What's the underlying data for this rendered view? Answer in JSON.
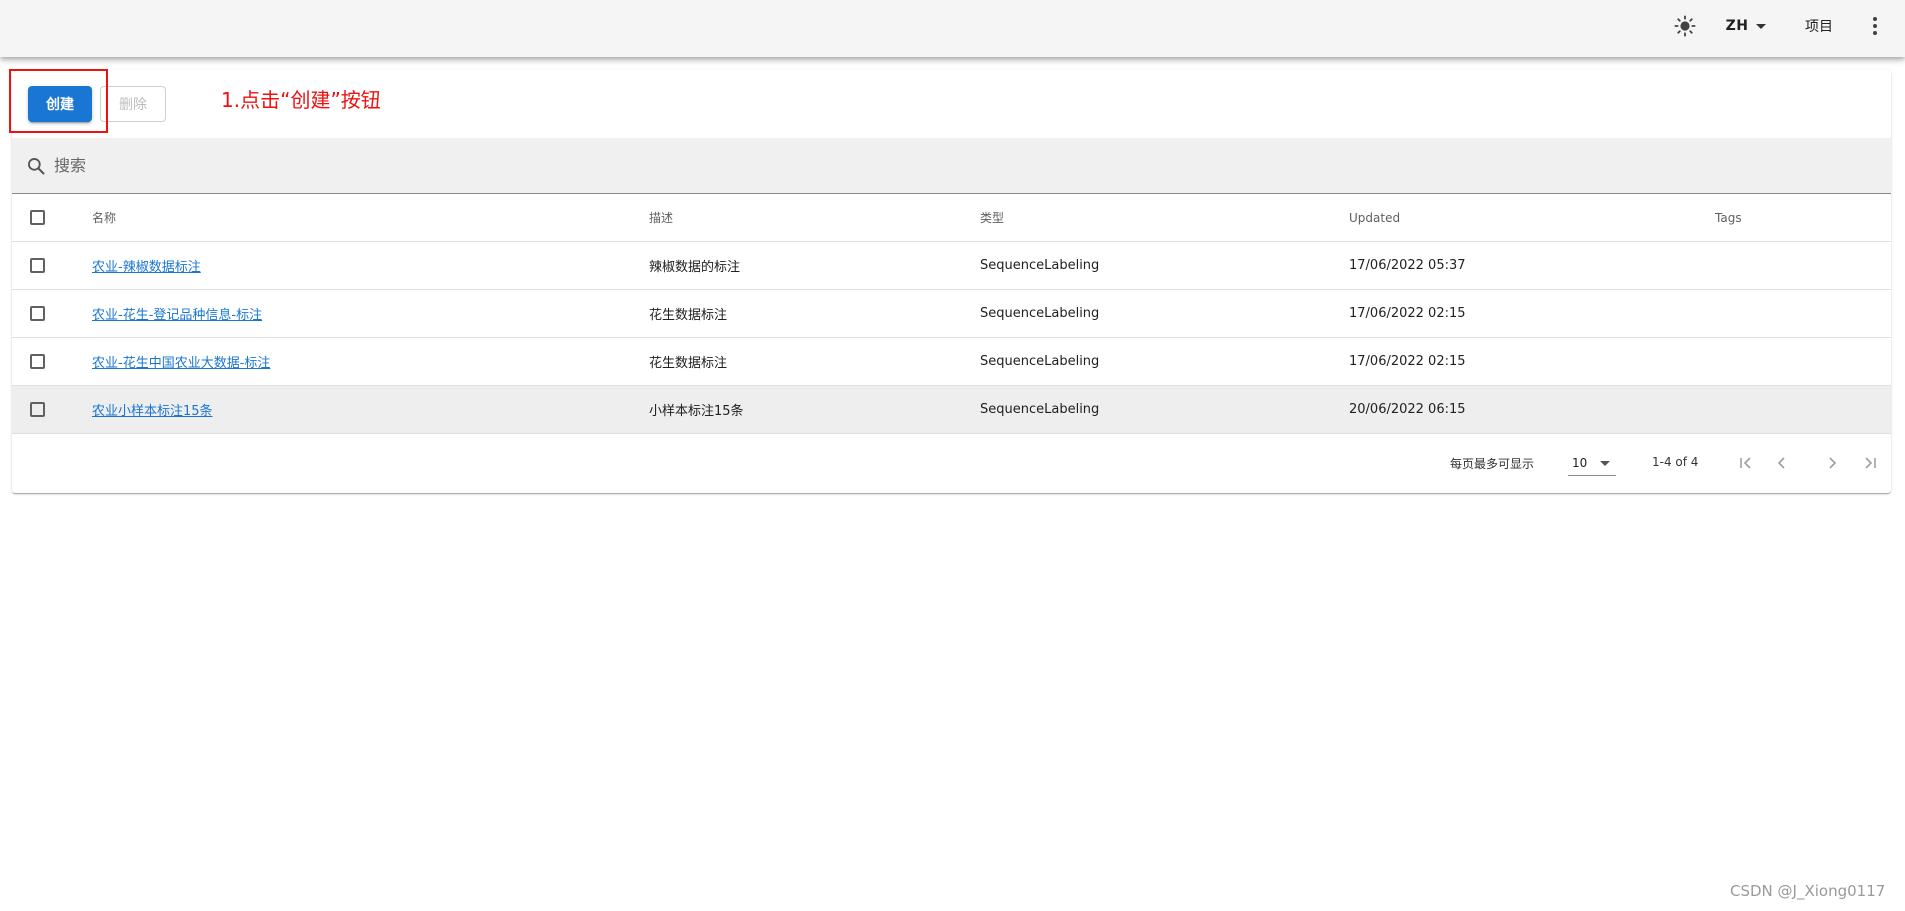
{
  "appbar": {
    "language": "ZH",
    "projects_label": "项目"
  },
  "toolbar": {
    "create_label": "创建",
    "delete_label": "删除"
  },
  "annotation": "1.点击“创建”按钮",
  "search": {
    "placeholder": "搜索"
  },
  "table": {
    "headers": {
      "name": "名称",
      "description": "描述",
      "type": "类型",
      "updated": "Updated",
      "tags": "Tags"
    },
    "rows": [
      {
        "name": "农业-辣椒数据标注",
        "description": "辣椒数据的标注",
        "type": "SequenceLabeling",
        "updated": "17/06/2022 05:37",
        "tags": ""
      },
      {
        "name": "农业-花生-登记品种信息-标注",
        "description": "花生数据标注",
        "type": "SequenceLabeling",
        "updated": "17/06/2022 02:15",
        "tags": ""
      },
      {
        "name": "农业-花生中国农业大数据-标注",
        "description": "花生数据标注",
        "type": "SequenceLabeling",
        "updated": "17/06/2022 02:15",
        "tags": ""
      },
      {
        "name": "农业小样本标注15条",
        "description": "小样本标注15条",
        "type": "SequenceLabeling",
        "updated": "20/06/2022 06:15",
        "tags": ""
      }
    ]
  },
  "pagination": {
    "rows_per_page_label": "每页最多可显示",
    "rows_per_page_value": "10",
    "range_text": "1-4 of 4"
  },
  "watermark": "CSDN @J_Xiong0117",
  "colors": {
    "primary": "#1976d2",
    "annotation_red": "#ee1111"
  }
}
